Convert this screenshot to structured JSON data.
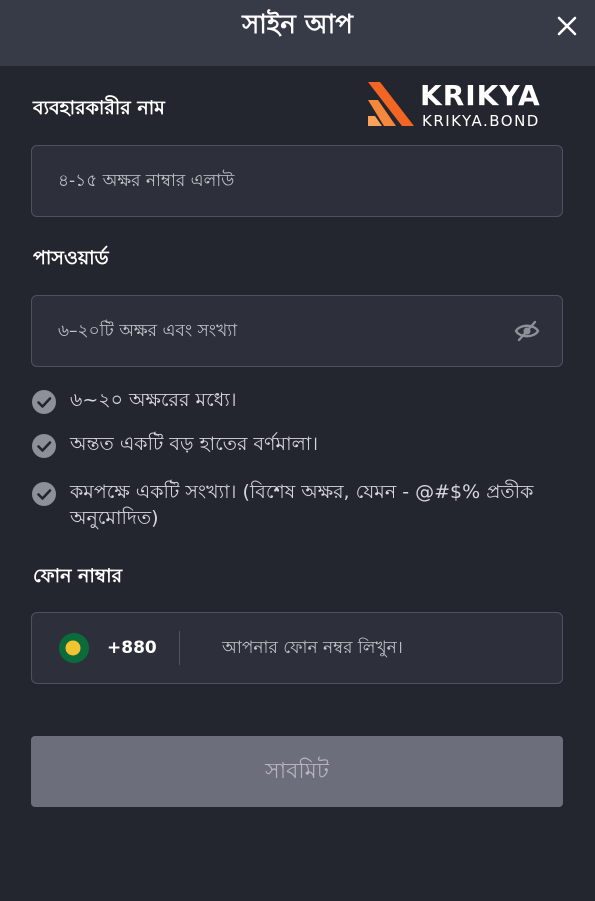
{
  "header": {
    "title": "সাইন আপ",
    "close_icon": "close-icon"
  },
  "logo": {
    "name": "KRIKYA",
    "domain": "KRIKYA.BOND",
    "mark_color": "#f26522"
  },
  "username": {
    "label": "ব্যবহারকারীর নাম",
    "placeholder": "৪-১৫ অক্ষর নাম্বার এলাউ"
  },
  "password": {
    "label": "পাসওয়ার্ড",
    "placeholder": "৬–২০টি অক্ষর এবং সংখ্যা",
    "toggle_icon": "eye-off-icon"
  },
  "password_rules": [
    {
      "text": "৬~২০ অক্ষরের মধ্যে।",
      "icon": "check-circle-icon"
    },
    {
      "text": "অন্তত একটি বড় হাতের বর্ণমালা।",
      "icon": "check-circle-icon"
    },
    {
      "text": "কমপক্ষে একটি সংখ্যা। (বিশেষ অক্ষর, যেমন - @#$% প্রতীক অনুমোদিত)",
      "icon": "check-circle-icon"
    }
  ],
  "phone": {
    "label": "ফোন নাম্বার",
    "country_code": "+880",
    "flag_icon": "bangladesh-flag-icon",
    "placeholder": "আপনার ফোন নম্বর লিখুন।"
  },
  "submit": {
    "label": "সাবমিট"
  },
  "colors": {
    "background": "#23252f",
    "header": "#373a47",
    "field": "#2d303b",
    "field_border": "#4e5260",
    "submit_disabled": "#6c6e7b",
    "check": "#8d8f99"
  }
}
